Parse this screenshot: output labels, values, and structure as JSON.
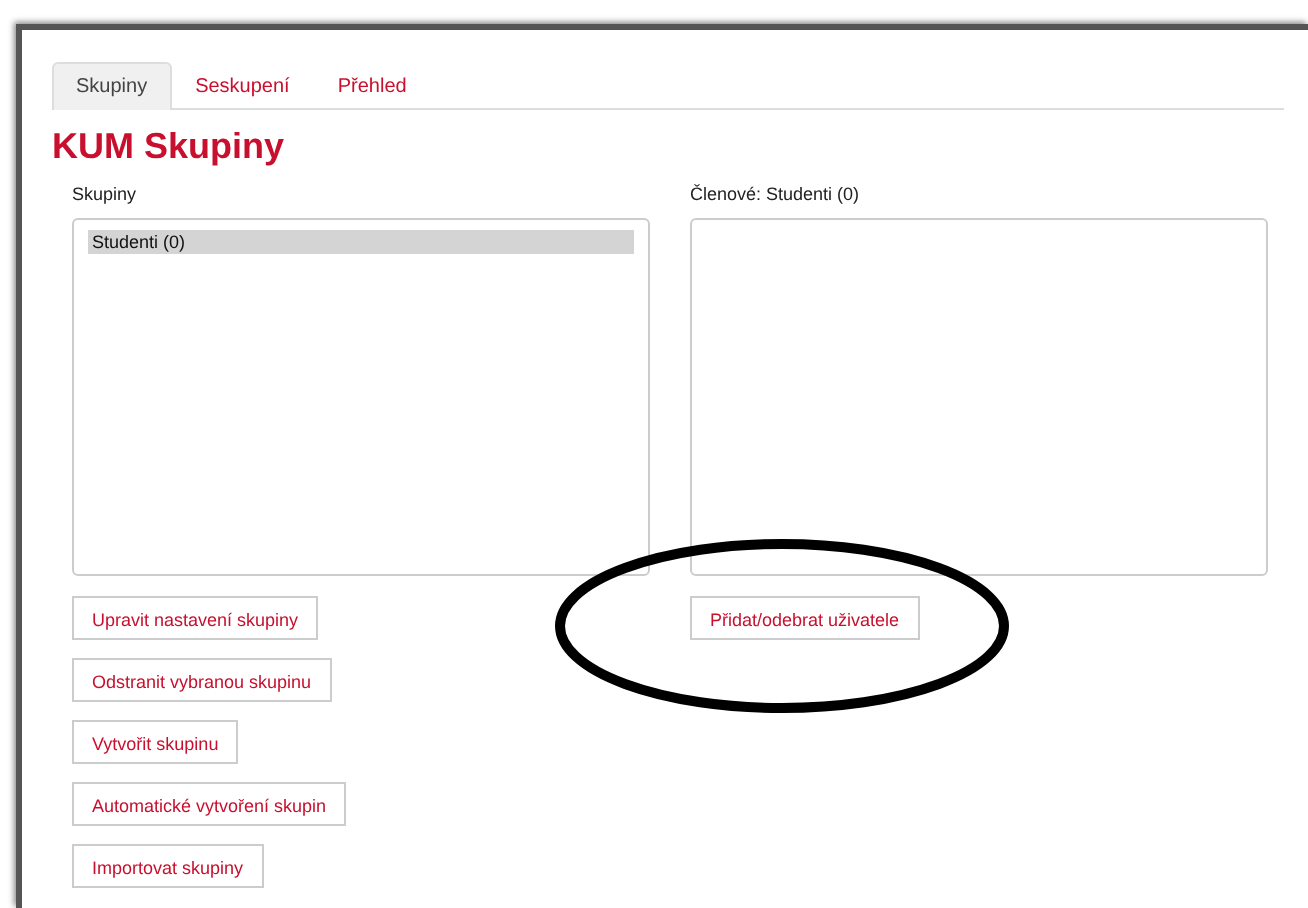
{
  "tabs": [
    {
      "label": "Skupiny",
      "selected": true
    },
    {
      "label": "Seskupení",
      "selected": false
    },
    {
      "label": "Přehled",
      "selected": false
    }
  ],
  "title": "KUM Skupiny",
  "groups": {
    "label": "Skupiny",
    "items": [
      {
        "label": "Studenti (0)",
        "selected": true
      }
    ],
    "buttons": [
      "Upravit nastavení skupiny",
      "Odstranit vybranou skupinu",
      "Vytvořit skupinu",
      "Automatické vytvoření skupin",
      "Importovat skupiny"
    ]
  },
  "members": {
    "label": "Členové: Studenti (0)",
    "buttons": [
      "Přidat/odebrat uživatele"
    ]
  }
}
